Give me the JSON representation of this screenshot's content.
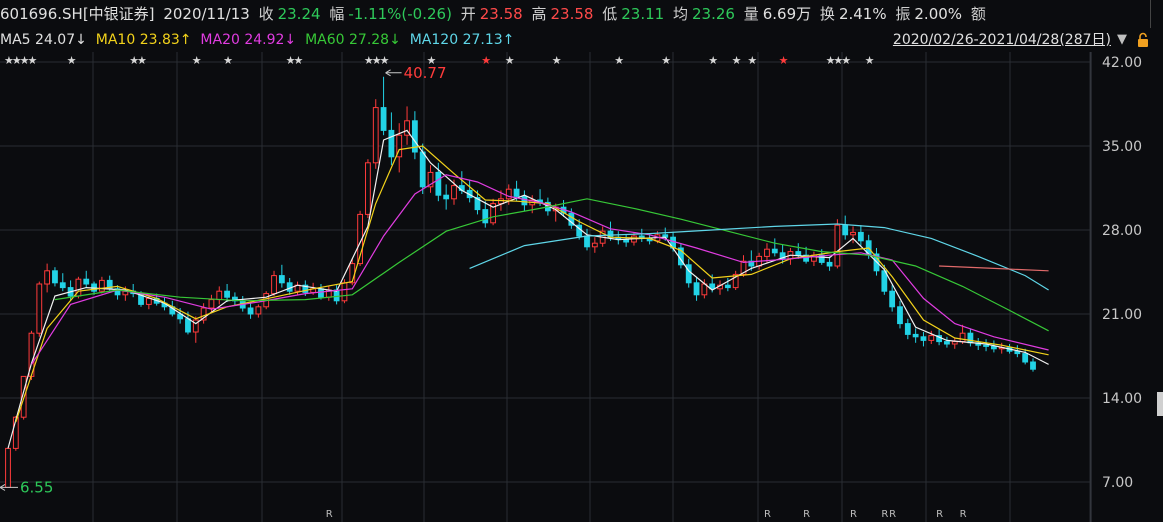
{
  "header": {
    "code": "601696.SH[中银证券]",
    "date": "2020/11/13",
    "close_label": "收",
    "close_value": "23.24",
    "change_label": "幅",
    "change_value": "-1.11%(-0.26)",
    "open_label": "开",
    "open_value": "23.58",
    "high_label": "高",
    "high_value": "23.58",
    "low_label": "低",
    "low_value": "23.11",
    "avg_label": "均",
    "avg_value": "23.26",
    "vol_label": "量",
    "vol_value": "6.69万",
    "turnover_label": "换",
    "turnover_value": "2.41%",
    "amp_label": "振",
    "amp_value": "2.00%",
    "amount_label": "额"
  },
  "ma_bar": {
    "ma5": "MA5",
    "ma5_value": "24.07↓",
    "ma10": "MA10",
    "ma10_value": "23.83↑",
    "ma20": "MA20",
    "ma20_value": "24.92↓",
    "ma60": "MA60",
    "ma60_value": "27.28↓",
    "ma120": "MA120",
    "ma120_value": "27.13↑",
    "range": "2020/02/26-2021/04/28(287日)"
  },
  "colors": {
    "up": "#ff3b3b",
    "down": "#22d3e6",
    "ma5": "#f2f2f2",
    "ma10": "#f2d21b",
    "ma20": "#e03ce0",
    "ma60": "#37c837",
    "ma120": "#5fd6e8",
    "ma250": "#e06a6a",
    "grid": "#2a2d33"
  },
  "chart_data": {
    "type": "candlestick",
    "y_ticks": [
      "42.00",
      "35.00",
      "28.00",
      "21.00",
      "14.00",
      "7.00"
    ],
    "ylim": [
      7,
      42
    ],
    "annotations": {
      "high": "40.77",
      "low": "6.55"
    },
    "bottom_markers": [
      "R",
      "R",
      "R",
      "R",
      "RR",
      "R",
      "R"
    ],
    "ohlc": [
      [
        6.55,
        9.8,
        6.55,
        9.8
      ],
      [
        9.8,
        12.5,
        9.6,
        12.4
      ],
      [
        12.4,
        15.8,
        12.2,
        15.8
      ],
      [
        15.8,
        19.6,
        15.5,
        19.4
      ],
      [
        19.4,
        23.7,
        19.1,
        23.5
      ],
      [
        23.5,
        25.2,
        22.8,
        24.6
      ],
      [
        24.6,
        24.9,
        23.3,
        23.6
      ],
      [
        23.6,
        24.4,
        22.9,
        23.2
      ],
      [
        23.2,
        23.8,
        22.1,
        22.5
      ],
      [
        22.5,
        24.1,
        22.3,
        23.9
      ],
      [
        23.9,
        24.6,
        23.2,
        23.5
      ],
      [
        23.5,
        23.7,
        22.6,
        22.9
      ],
      [
        22.9,
        24.1,
        22.7,
        23.8
      ],
      [
        23.8,
        24.2,
        22.9,
        23.1
      ],
      [
        23.1,
        23.4,
        22.2,
        22.6
      ],
      [
        22.6,
        23.3,
        22.1,
        22.9
      ],
      [
        22.9,
        23.5,
        22.4,
        22.7
      ],
      [
        22.7,
        22.9,
        21.6,
        21.8
      ],
      [
        21.8,
        22.6,
        21.4,
        22.3
      ],
      [
        22.3,
        22.7,
        21.7,
        21.9
      ],
      [
        21.9,
        22.4,
        21.3,
        21.6
      ],
      [
        21.6,
        22.1,
        20.8,
        21.0
      ],
      [
        21.0,
        21.5,
        20.2,
        20.6
      ],
      [
        20.6,
        21.2,
        19.3,
        19.5
      ],
      [
        19.5,
        20.8,
        18.6,
        20.5
      ],
      [
        20.5,
        21.9,
        20.2,
        21.5
      ],
      [
        21.5,
        22.6,
        21.1,
        22.2
      ],
      [
        22.2,
        23.3,
        21.8,
        22.9
      ],
      [
        22.9,
        23.5,
        22.0,
        22.4
      ],
      [
        22.4,
        22.8,
        21.7,
        22.1
      ],
      [
        22.1,
        22.5,
        21.2,
        21.5
      ],
      [
        21.5,
        21.9,
        20.6,
        21.0
      ],
      [
        21.0,
        21.8,
        20.7,
        21.6
      ],
      [
        21.6,
        22.9,
        21.4,
        22.7
      ],
      [
        22.7,
        24.6,
        22.5,
        24.2
      ],
      [
        24.2,
        25.1,
        23.2,
        23.6
      ],
      [
        23.6,
        24.0,
        22.6,
        22.9
      ],
      [
        22.9,
        23.7,
        22.6,
        23.4
      ],
      [
        23.4,
        23.8,
        22.5,
        22.8
      ],
      [
        22.8,
        23.6,
        22.6,
        23.1
      ],
      [
        23.1,
        23.5,
        22.2,
        22.4
      ],
      [
        22.4,
        23.3,
        22.1,
        23.0
      ],
      [
        23.0,
        23.4,
        21.8,
        22.1
      ],
      [
        22.1,
        23.9,
        21.9,
        23.6
      ],
      [
        23.6,
        25.6,
        23.4,
        25.2
      ],
      [
        25.2,
        29.6,
        25.0,
        29.3
      ],
      [
        29.3,
        33.9,
        29.0,
        33.6
      ],
      [
        33.6,
        38.9,
        33.1,
        38.2
      ],
      [
        38.2,
        40.77,
        35.9,
        36.3
      ],
      [
        36.3,
        37.8,
        33.4,
        34.1
      ],
      [
        34.1,
        36.9,
        32.8,
        35.9
      ],
      [
        35.9,
        38.3,
        35.1,
        37.1
      ],
      [
        37.1,
        37.9,
        33.9,
        34.5
      ],
      [
        34.5,
        35.2,
        31.0,
        31.6
      ],
      [
        31.6,
        33.4,
        31.1,
        32.8
      ],
      [
        32.8,
        33.6,
        30.4,
        30.9
      ],
      [
        30.9,
        31.8,
        29.7,
        30.6
      ],
      [
        30.6,
        32.2,
        30.1,
        31.7
      ],
      [
        31.7,
        32.9,
        31.0,
        31.3
      ],
      [
        31.3,
        32.2,
        30.3,
        30.7
      ],
      [
        30.7,
        31.3,
        29.3,
        29.7
      ],
      [
        29.7,
        30.4,
        28.2,
        28.6
      ],
      [
        28.6,
        30.6,
        28.4,
        30.2
      ],
      [
        30.2,
        31.3,
        29.6,
        30.6
      ],
      [
        30.6,
        31.8,
        30.1,
        31.4
      ],
      [
        31.4,
        32.1,
        30.4,
        30.8
      ],
      [
        30.8,
        31.3,
        29.6,
        30.1
      ],
      [
        30.1,
        30.9,
        29.4,
        30.5
      ],
      [
        30.5,
        31.4,
        30.0,
        30.3
      ],
      [
        30.3,
        30.7,
        29.2,
        29.6
      ],
      [
        29.6,
        30.2,
        28.7,
        29.9
      ],
      [
        29.9,
        30.5,
        29.1,
        29.4
      ],
      [
        29.4,
        29.8,
        28.1,
        28.4
      ],
      [
        28.4,
        28.9,
        27.2,
        27.5
      ],
      [
        27.5,
        28.1,
        26.3,
        26.6
      ],
      [
        26.6,
        27.4,
        26.1,
        26.9
      ],
      [
        26.9,
        28.3,
        26.6,
        27.9
      ],
      [
        27.9,
        28.7,
        27.1,
        27.4
      ],
      [
        27.4,
        27.9,
        26.8,
        27.2
      ],
      [
        27.2,
        27.6,
        26.6,
        27.0
      ],
      [
        27.0,
        27.8,
        26.7,
        27.5
      ],
      [
        27.5,
        28.1,
        27.0,
        27.3
      ],
      [
        27.3,
        27.7,
        26.8,
        27.1
      ],
      [
        27.1,
        27.9,
        26.9,
        27.6
      ],
      [
        27.6,
        28.2,
        27.1,
        27.4
      ],
      [
        27.4,
        27.8,
        26.2,
        26.5
      ],
      [
        26.5,
        26.9,
        24.8,
        25.1
      ],
      [
        25.1,
        25.6,
        23.2,
        23.6
      ],
      [
        23.6,
        24.1,
        22.1,
        22.6
      ],
      [
        22.6,
        23.9,
        22.3,
        23.5
      ],
      [
        23.5,
        24.3,
        22.8,
        23.1
      ],
      [
        23.1,
        23.8,
        22.6,
        23.4
      ],
      [
        23.4,
        24.0,
        22.9,
        23.2
      ],
      [
        23.2,
        24.6,
        23.0,
        24.3
      ],
      [
        24.3,
        25.9,
        24.1,
        25.4
      ],
      [
        25.4,
        26.3,
        24.6,
        25.0
      ],
      [
        25.0,
        26.1,
        24.7,
        25.8
      ],
      [
        25.8,
        26.9,
        25.3,
        26.4
      ],
      [
        26.4,
        27.3,
        25.8,
        26.1
      ],
      [
        26.1,
        26.8,
        25.2,
        25.6
      ],
      [
        25.6,
        26.5,
        25.1,
        26.2
      ],
      [
        26.2,
        26.9,
        25.6,
        25.9
      ],
      [
        25.9,
        26.6,
        25.2,
        25.4
      ],
      [
        25.4,
        26.2,
        25.0,
        25.9
      ],
      [
        25.9,
        26.4,
        25.1,
        25.3
      ],
      [
        25.3,
        25.8,
        24.6,
        25.0
      ],
      [
        25.0,
        28.9,
        24.8,
        28.4
      ],
      [
        28.4,
        29.2,
        27.2,
        27.6
      ],
      [
        27.6,
        28.3,
        26.9,
        27.8
      ],
      [
        27.8,
        28.4,
        26.7,
        27.1
      ],
      [
        27.1,
        27.6,
        25.6,
        26.0
      ],
      [
        26.0,
        26.5,
        24.2,
        24.6
      ],
      [
        24.6,
        25.1,
        22.6,
        22.9
      ],
      [
        22.9,
        23.4,
        21.2,
        21.6
      ],
      [
        21.6,
        22.1,
        19.8,
        20.2
      ],
      [
        20.2,
        20.6,
        18.9,
        19.3
      ],
      [
        19.3,
        19.8,
        18.6,
        19.1
      ],
      [
        19.1,
        19.5,
        18.3,
        18.8
      ],
      [
        18.8,
        19.6,
        18.5,
        19.2
      ],
      [
        19.2,
        19.7,
        18.4,
        18.7
      ],
      [
        18.7,
        19.1,
        18.2,
        18.5
      ],
      [
        18.5,
        19.0,
        18.1,
        18.7
      ],
      [
        18.7,
        20.1,
        18.5,
        19.4
      ],
      [
        19.4,
        19.8,
        18.3,
        18.6
      ],
      [
        18.6,
        19.0,
        18.0,
        18.4
      ],
      [
        18.4,
        18.9,
        17.9,
        18.3
      ],
      [
        18.3,
        18.8,
        17.8,
        18.1
      ],
      [
        18.1,
        18.6,
        17.7,
        18.2
      ],
      [
        18.2,
        18.5,
        17.7,
        17.9
      ],
      [
        17.9,
        18.4,
        17.4,
        17.7
      ],
      [
        17.7,
        18.1,
        16.8,
        17.0
      ],
      [
        17.0,
        17.3,
        16.2,
        16.4
      ]
    ],
    "ma_lines": [
      {
        "name": "MA5",
        "values": [
          [
            0,
            9.8
          ],
          [
            3,
            16.9
          ],
          [
            6,
            22.5
          ],
          [
            10,
            23.2
          ],
          [
            15,
            23.0
          ],
          [
            20,
            21.9
          ],
          [
            24,
            20.2
          ],
          [
            28,
            22.1
          ],
          [
            33,
            22.4
          ],
          [
            37,
            23.4
          ],
          [
            42,
            22.9
          ],
          [
            46,
            28.3
          ],
          [
            48,
            35.5
          ],
          [
            51,
            36.3
          ],
          [
            54,
            33.6
          ],
          [
            58,
            31.3
          ],
          [
            62,
            29.9
          ],
          [
            66,
            30.9
          ],
          [
            70,
            29.7
          ],
          [
            74,
            27.6
          ],
          [
            78,
            27.2
          ],
          [
            84,
            27.4
          ],
          [
            87,
            24.6
          ],
          [
            90,
            23.0
          ],
          [
            95,
            24.8
          ],
          [
            100,
            25.9
          ],
          [
            105,
            25.7
          ],
          [
            108,
            27.3
          ],
          [
            112,
            24.7
          ],
          [
            116,
            19.9
          ],
          [
            120,
            18.8
          ],
          [
            125,
            18.5
          ],
          [
            130,
            17.8
          ],
          [
            133,
            16.8
          ]
        ]
      },
      {
        "name": "MA10",
        "values": [
          [
            1,
            12.0
          ],
          [
            5,
            19.8
          ],
          [
            9,
            22.9
          ],
          [
            14,
            23.3
          ],
          [
            19,
            22.3
          ],
          [
            24,
            20.6
          ],
          [
            28,
            21.6
          ],
          [
            34,
            22.4
          ],
          [
            39,
            23.1
          ],
          [
            44,
            23.7
          ],
          [
            47,
            30.2
          ],
          [
            50,
            34.7
          ],
          [
            53,
            35.0
          ],
          [
            57,
            32.7
          ],
          [
            61,
            30.5
          ],
          [
            65,
            30.4
          ],
          [
            69,
            30.2
          ],
          [
            73,
            28.7
          ],
          [
            77,
            27.4
          ],
          [
            82,
            27.3
          ],
          [
            86,
            26.3
          ],
          [
            90,
            24.0
          ],
          [
            95,
            24.3
          ],
          [
            100,
            25.6
          ],
          [
            106,
            26.2
          ],
          [
            110,
            26.5
          ],
          [
            113,
            24.1
          ],
          [
            117,
            20.5
          ],
          [
            121,
            19.0
          ],
          [
            127,
            18.4
          ],
          [
            133,
            17.6
          ]
        ]
      },
      {
        "name": "MA20",
        "values": [
          [
            3,
            16.8
          ],
          [
            8,
            21.8
          ],
          [
            14,
            23.0
          ],
          [
            20,
            22.4
          ],
          [
            26,
            21.4
          ],
          [
            32,
            22.0
          ],
          [
            38,
            22.7
          ],
          [
            44,
            23.1
          ],
          [
            48,
            27.5
          ],
          [
            52,
            31.0
          ],
          [
            56,
            32.6
          ],
          [
            60,
            32.0
          ],
          [
            64,
            30.8
          ],
          [
            68,
            30.3
          ],
          [
            72,
            29.5
          ],
          [
            77,
            28.1
          ],
          [
            82,
            27.6
          ],
          [
            88,
            26.5
          ],
          [
            94,
            25.3
          ],
          [
            100,
            25.6
          ],
          [
            105,
            25.9
          ],
          [
            109,
            26.1
          ],
          [
            113,
            25.5
          ],
          [
            117,
            22.3
          ],
          [
            121,
            20.2
          ],
          [
            126,
            19.1
          ],
          [
            133,
            18.0
          ]
        ]
      },
      {
        "name": "MA60",
        "values": [
          [
            6,
            22.2
          ],
          [
            14,
            23.0
          ],
          [
            22,
            22.4
          ],
          [
            30,
            22.1
          ],
          [
            38,
            22.2
          ],
          [
            44,
            22.6
          ],
          [
            50,
            25.3
          ],
          [
            56,
            27.9
          ],
          [
            62,
            29.1
          ],
          [
            68,
            29.8
          ],
          [
            74,
            30.6
          ],
          [
            80,
            29.8
          ],
          [
            86,
            28.9
          ],
          [
            92,
            27.9
          ],
          [
            98,
            26.9
          ],
          [
            104,
            26.2
          ],
          [
            110,
            25.9
          ],
          [
            116,
            25.0
          ],
          [
            122,
            23.3
          ],
          [
            128,
            21.3
          ],
          [
            133,
            19.6
          ]
        ]
      },
      {
        "name": "MA120",
        "values": [
          [
            59,
            24.8
          ],
          [
            66,
            26.7
          ],
          [
            74,
            27.5
          ],
          [
            82,
            27.7
          ],
          [
            90,
            28.0
          ],
          [
            98,
            28.3
          ],
          [
            106,
            28.5
          ],
          [
            112,
            28.2
          ],
          [
            118,
            27.3
          ],
          [
            124,
            25.8
          ],
          [
            130,
            24.2
          ],
          [
            133,
            23.0
          ]
        ]
      },
      {
        "name": "MA250",
        "values": [
          [
            119,
            25.0
          ],
          [
            126,
            24.8
          ],
          [
            133,
            24.6
          ]
        ]
      }
    ],
    "star_slots": [
      0,
      1,
      2,
      3,
      8,
      16,
      17,
      24,
      28,
      36,
      37,
      46,
      47,
      48,
      54,
      61,
      64,
      70,
      78,
      84,
      90,
      93,
      95,
      99,
      105,
      106,
      107,
      110
    ],
    "r_slots": [
      41,
      97,
      102,
      108,
      112,
      113,
      119,
      122
    ]
  }
}
